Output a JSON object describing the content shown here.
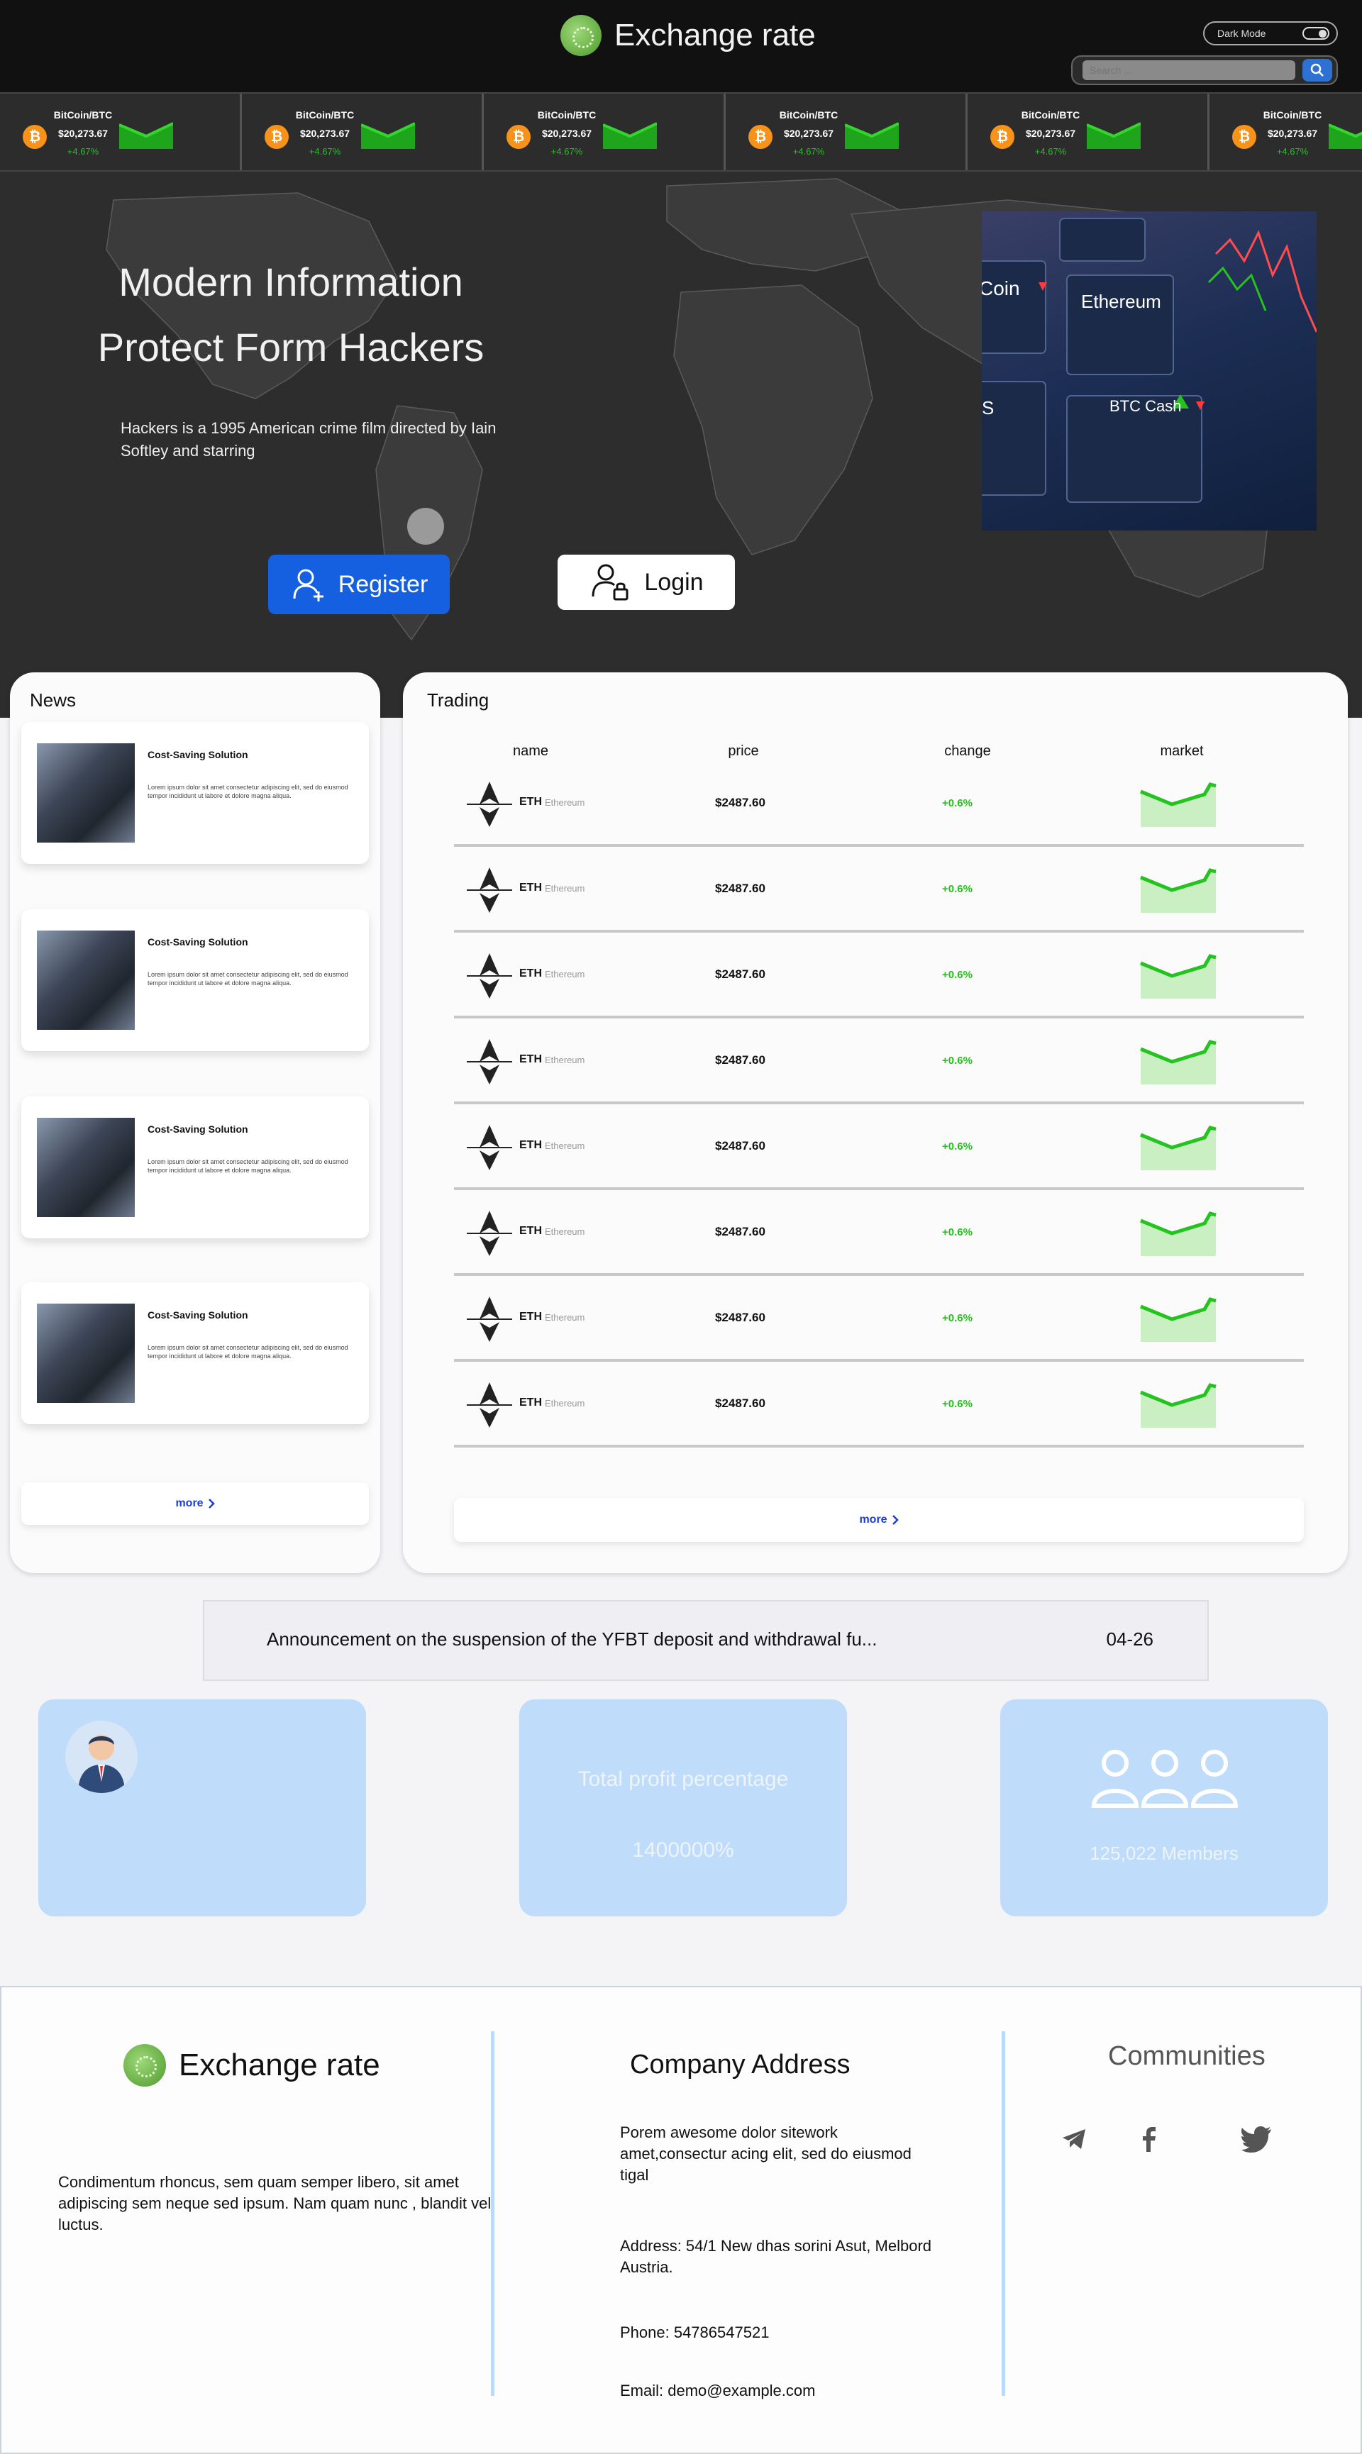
{
  "header": {
    "title": "Exchange rate",
    "theme_toggle_label": "Dark Mode",
    "search_placeholder": "Search ..."
  },
  "ticker": [
    {
      "pair": "BitCoin/BTC",
      "price": "$20,273.67",
      "change": "+4.67%",
      "coin_symbol": "₿"
    },
    {
      "pair": "BitCoin/BTC",
      "price": "$20,273.67",
      "change": "+4.67%",
      "coin_symbol": "₿"
    },
    {
      "pair": "BitCoin/BTC",
      "price": "$20,273.67",
      "change": "+4.67%",
      "coin_symbol": "₿"
    },
    {
      "pair": "BitCoin/BTC",
      "price": "$20,273.67",
      "change": "+4.67%",
      "coin_symbol": "₿"
    },
    {
      "pair": "BitCoin/BTC",
      "price": "$20,273.67",
      "change": "+4.67%",
      "coin_symbol": "₿"
    },
    {
      "pair": "BitCoin/BTC",
      "price": "$20,273.67",
      "change": "+4.67%",
      "coin_symbol": "₿"
    }
  ],
  "hero": {
    "title_line1": "Modern Information",
    "title_line2": "Protect Form Hackers",
    "subtitle": "Hackers is a 1995 American crime film directed by Iain Softley and starring",
    "register_label": "Register",
    "login_label": "Login",
    "image_labels": {
      "ethereum": "Ethereum",
      "btc_cash": "BTC Cash",
      "coin": "Coin",
      "s": "S"
    }
  },
  "news": {
    "title": "News",
    "items": [
      {
        "headline": "Cost-Saving Solution",
        "body": "Lorem ipsum dolor sit amet consectetur adipiscing elit, sed do eiusmod tempor incididunt ut labore et dolore magna aliqua."
      },
      {
        "headline": "Cost-Saving Solution",
        "body": "Lorem ipsum dolor sit amet consectetur adipiscing elit, sed do eiusmod tempor incididunt ut labore et dolore magna aliqua."
      },
      {
        "headline": "Cost-Saving Solution",
        "body": "Lorem ipsum dolor sit amet consectetur adipiscing elit, sed do eiusmod tempor incididunt ut labore et dolore magna aliqua."
      },
      {
        "headline": "Cost-Saving Solution",
        "body": "Lorem ipsum dolor sit amet consectetur adipiscing elit, sed do eiusmod tempor incididunt ut labore et dolore magna aliqua."
      }
    ],
    "more_label": "more"
  },
  "trading": {
    "title": "Trading",
    "columns": [
      "name",
      "price",
      "change",
      "market"
    ],
    "rows": [
      {
        "symbol": "ETH",
        "name": "Ethereum",
        "price": "$2487.60",
        "change": "+0.6%"
      },
      {
        "symbol": "ETH",
        "name": "Ethereum",
        "price": "$2487.60",
        "change": "+0.6%"
      },
      {
        "symbol": "ETH",
        "name": "Ethereum",
        "price": "$2487.60",
        "change": "+0.6%"
      },
      {
        "symbol": "ETH",
        "name": "Ethereum",
        "price": "$2487.60",
        "change": "+0.6%"
      },
      {
        "symbol": "ETH",
        "name": "Ethereum",
        "price": "$2487.60",
        "change": "+0.6%"
      },
      {
        "symbol": "ETH",
        "name": "Ethereum",
        "price": "$2487.60",
        "change": "+0.6%"
      },
      {
        "symbol": "ETH",
        "name": "Ethereum",
        "price": "$2487.60",
        "change": "+0.6%"
      },
      {
        "symbol": "ETH",
        "name": "Ethereum",
        "price": "$2487.60",
        "change": "+0.6%"
      }
    ],
    "more_label": "more"
  },
  "announcement": {
    "text": "Announcement on the suspension of the YFBT deposit and withdrawal fu...",
    "date": "04-26"
  },
  "stats": {
    "profit_title": "Total profit percentage",
    "profit_value": "1400000%",
    "members": "125,022 Members"
  },
  "footer": {
    "brand": "Exchange rate",
    "description": "Condimentum rhoncus, sem quam semper libero, sit amet adipiscing sem neque sed ipsum. Nam quam nunc , blandit vel, luctus.",
    "address_title": "Company Address",
    "address_intro": "Porem awesome dolor sitework amet,consectur acing elit, sed do eiusmod tigal",
    "address": "Address: 54/1 New dhas sorini Asut, Melbord Austria.",
    "phone": "Phone: 54786547521",
    "email": "Email: demo@example.com",
    "communities_title": "Communities"
  },
  "colors": {
    "accent_blue": "#1560e0",
    "positive_green": "#27c11e",
    "stat_card": "#bfdcfb",
    "header_bg": "#111111",
    "hero_bg": "#2d2d2d"
  },
  "icons": {
    "search": "search-icon",
    "register": "user-plus-icon",
    "login": "user-lock-icon",
    "more": "chevron-right-icon",
    "eth": "ethereum-icon",
    "telegram": "telegram-icon",
    "facebook": "facebook-icon",
    "twitter": "twitter-icon",
    "members": "users-icon"
  }
}
